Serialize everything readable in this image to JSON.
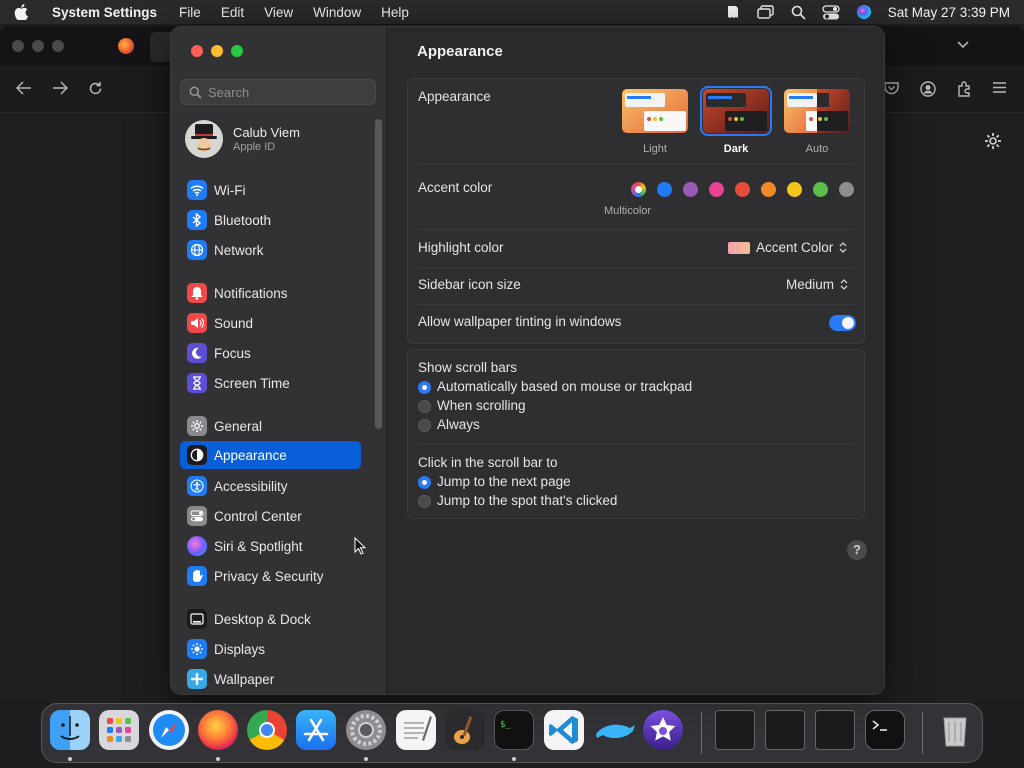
{
  "menubar": {
    "app_name": "System Settings",
    "menus": [
      "File",
      "Edit",
      "View",
      "Window",
      "Help"
    ],
    "clock": "Sat May 27  3:39 PM"
  },
  "sidebar": {
    "search_placeholder": "Search",
    "account": {
      "name": "Calub Viem",
      "subtitle": "Apple ID"
    },
    "items": [
      {
        "label": "Wi-Fi",
        "icon": "wifi-icon",
        "color": "#1f7cf5"
      },
      {
        "label": "Bluetooth",
        "icon": "bluetooth-icon",
        "color": "#1f7cf5"
      },
      {
        "label": "Network",
        "icon": "globe-icon",
        "color": "#1f7cf5"
      },
      {
        "label": "Notifications",
        "icon": "bell-icon",
        "color": "#f0484a"
      },
      {
        "label": "Sound",
        "icon": "speaker-icon",
        "color": "#f0484a"
      },
      {
        "label": "Focus",
        "icon": "moon-icon",
        "color": "#5b4fd6"
      },
      {
        "label": "Screen Time",
        "icon": "hourglass-icon",
        "color": "#5b4fd6"
      },
      {
        "label": "General",
        "icon": "gear-icon",
        "color": "#8a8a8e"
      },
      {
        "label": "Appearance",
        "icon": "appearance-icon",
        "color": "#1b1b1d",
        "selected": true
      },
      {
        "label": "Accessibility",
        "icon": "accessibility-icon",
        "color": "#1f7cf5"
      },
      {
        "label": "Control Center",
        "icon": "toggles-icon",
        "color": "#8a8a8e"
      },
      {
        "label": "Siri & Spotlight",
        "icon": "siri-icon",
        "color": "#8c4bd8"
      },
      {
        "label": "Privacy & Security",
        "icon": "hand-icon",
        "color": "#1f7cf5"
      },
      {
        "label": "Desktop & Dock",
        "icon": "dock-icon",
        "color": "#1b1b1d"
      },
      {
        "label": "Displays",
        "icon": "sun-icon",
        "color": "#1f7cf5"
      },
      {
        "label": "Wallpaper",
        "icon": "wallpaper-icon",
        "color": "#37a8e8"
      }
    ]
  },
  "content": {
    "title": "Appearance",
    "appearance": {
      "label": "Appearance",
      "options": [
        "Light",
        "Dark",
        "Auto"
      ],
      "selected": "Dark"
    },
    "accent": {
      "label": "Accent color",
      "selected_label": "Multicolor",
      "colors": [
        "#1f7cf5",
        "#9b59b6",
        "#e84393",
        "#e74c3c",
        "#f08a24",
        "#f5c518",
        "#5bbf4a",
        "#8e8e92"
      ]
    },
    "highlight": {
      "label": "Highlight color",
      "value": "Accent Color"
    },
    "icon_size": {
      "label": "Sidebar icon size",
      "value": "Medium"
    },
    "tinting": {
      "label": "Allow wallpaper tinting in windows",
      "enabled": true
    },
    "scroll_bars": {
      "label": "Show scroll bars",
      "options": [
        "Automatically based on mouse or trackpad",
        "When scrolling",
        "Always"
      ],
      "selected": 0
    },
    "click_scroll": {
      "label": "Click in the scroll bar to",
      "options": [
        "Jump to the next page",
        "Jump to the spot that's clicked"
      ],
      "selected": 0
    },
    "help": "?"
  },
  "dock": {
    "apps": [
      "Finder",
      "Launchpad",
      "Safari",
      "Firefox",
      "Chrome",
      "App Store",
      "System Settings",
      "TextEdit",
      "GarageBand",
      "Terminal",
      "VS Code",
      "Dolphin",
      "iMovie"
    ]
  }
}
